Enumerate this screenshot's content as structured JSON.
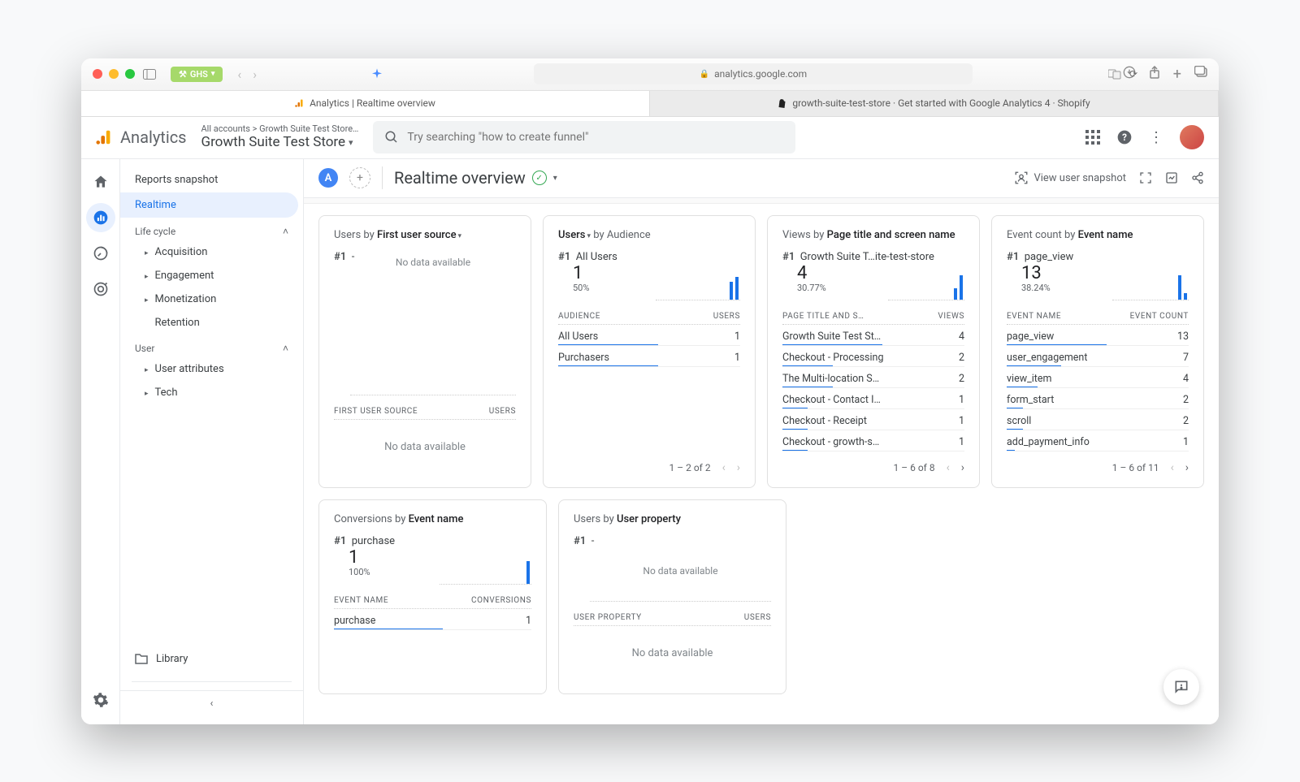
{
  "browser": {
    "ghs_badge": "GHS",
    "url_host": "analytics.google.com",
    "tabs": [
      {
        "label": "Analytics | Realtime overview",
        "active": true
      },
      {
        "label": "growth-suite-test-store · Get started with Google Analytics 4 · Shopify",
        "active": false
      }
    ]
  },
  "ga_header": {
    "product": "Analytics",
    "crumb_top": "All accounts > Growth Suite Test Store…",
    "crumb_bottom": "Growth Suite Test Store",
    "search_placeholder": "Try searching \"how to create funnel\""
  },
  "subheader": {
    "segment_letter": "A",
    "title": "Realtime overview",
    "view_snapshot": "View user snapshot"
  },
  "sidebar": {
    "snapshot": "Reports snapshot",
    "realtime": "Realtime",
    "lifecycle_label": "Life cycle",
    "lifecycle": [
      "Acquisition",
      "Engagement",
      "Monetization",
      "Retention"
    ],
    "user_label": "User",
    "user": [
      "User attributes",
      "Tech"
    ],
    "library": "Library"
  },
  "cards": {
    "first_source": {
      "prefix": "Users by ",
      "dim": "First user source",
      "rank": "#1",
      "top": "-",
      "no_data": "No data available",
      "col_left": "FIRST USER SOURCE",
      "col_right": "USERS",
      "empty": "No data available"
    },
    "audience": {
      "prefix": "Users",
      "suffix": " by Audience",
      "rank": "#1",
      "top": "All Users",
      "value": "1",
      "pct": "50%",
      "col_left": "AUDIENCE",
      "col_right": "USERS",
      "rows": [
        {
          "k": "All Users",
          "v": "1",
          "bar": 100
        },
        {
          "k": "Purchasers",
          "v": "1",
          "bar": 100
        }
      ],
      "pager": "1 – 2 of 2"
    },
    "views": {
      "prefix": "Views by ",
      "dim": "Page title and screen name",
      "rank": "#1",
      "top": "Growth Suite T…ite-test-store",
      "value": "4",
      "pct": "30.77%",
      "col_left": "PAGE TITLE AND S…",
      "col_right": "VIEWS",
      "rows": [
        {
          "k": "Growth Suite Test St…",
          "v": "4",
          "bar": 100
        },
        {
          "k": "Checkout - Processing",
          "v": "2",
          "bar": 50
        },
        {
          "k": "The Multi-location S…",
          "v": "2",
          "bar": 50
        },
        {
          "k": "Checkout - Contact I…",
          "v": "1",
          "bar": 25
        },
        {
          "k": "Checkout - Receipt",
          "v": "1",
          "bar": 25
        },
        {
          "k": "Checkout - growth-s…",
          "v": "1",
          "bar": 25
        }
      ],
      "pager": "1 – 6 of 8"
    },
    "event_count": {
      "prefix": "Event count by ",
      "dim": "Event name",
      "rank": "#1",
      "top": "page_view",
      "value": "13",
      "pct": "38.24%",
      "col_left": "EVENT NAME",
      "col_right": "EVENT COUNT",
      "rows": [
        {
          "k": "page_view",
          "v": "13",
          "bar": 100
        },
        {
          "k": "user_engagement",
          "v": "7",
          "bar": 54
        },
        {
          "k": "view_item",
          "v": "4",
          "bar": 31
        },
        {
          "k": "form_start",
          "v": "2",
          "bar": 16
        },
        {
          "k": "scroll",
          "v": "2",
          "bar": 16
        },
        {
          "k": "add_payment_info",
          "v": "1",
          "bar": 8
        }
      ],
      "pager": "1 – 6 of 11"
    },
    "conversions": {
      "prefix": "Conversions by ",
      "dim": "Event name",
      "rank": "#1",
      "top": "purchase",
      "value": "1",
      "pct": "100%",
      "col_left": "EVENT NAME",
      "col_right": "CONVERSIONS",
      "rows": [
        {
          "k": "purchase",
          "v": "1",
          "bar": 100
        }
      ]
    },
    "user_property": {
      "prefix": "Users by ",
      "dim": "User property",
      "rank": "#1",
      "top": "-",
      "no_data": "No data available",
      "col_left": "USER PROPERTY",
      "col_right": "USERS",
      "empty": "No data available"
    }
  }
}
